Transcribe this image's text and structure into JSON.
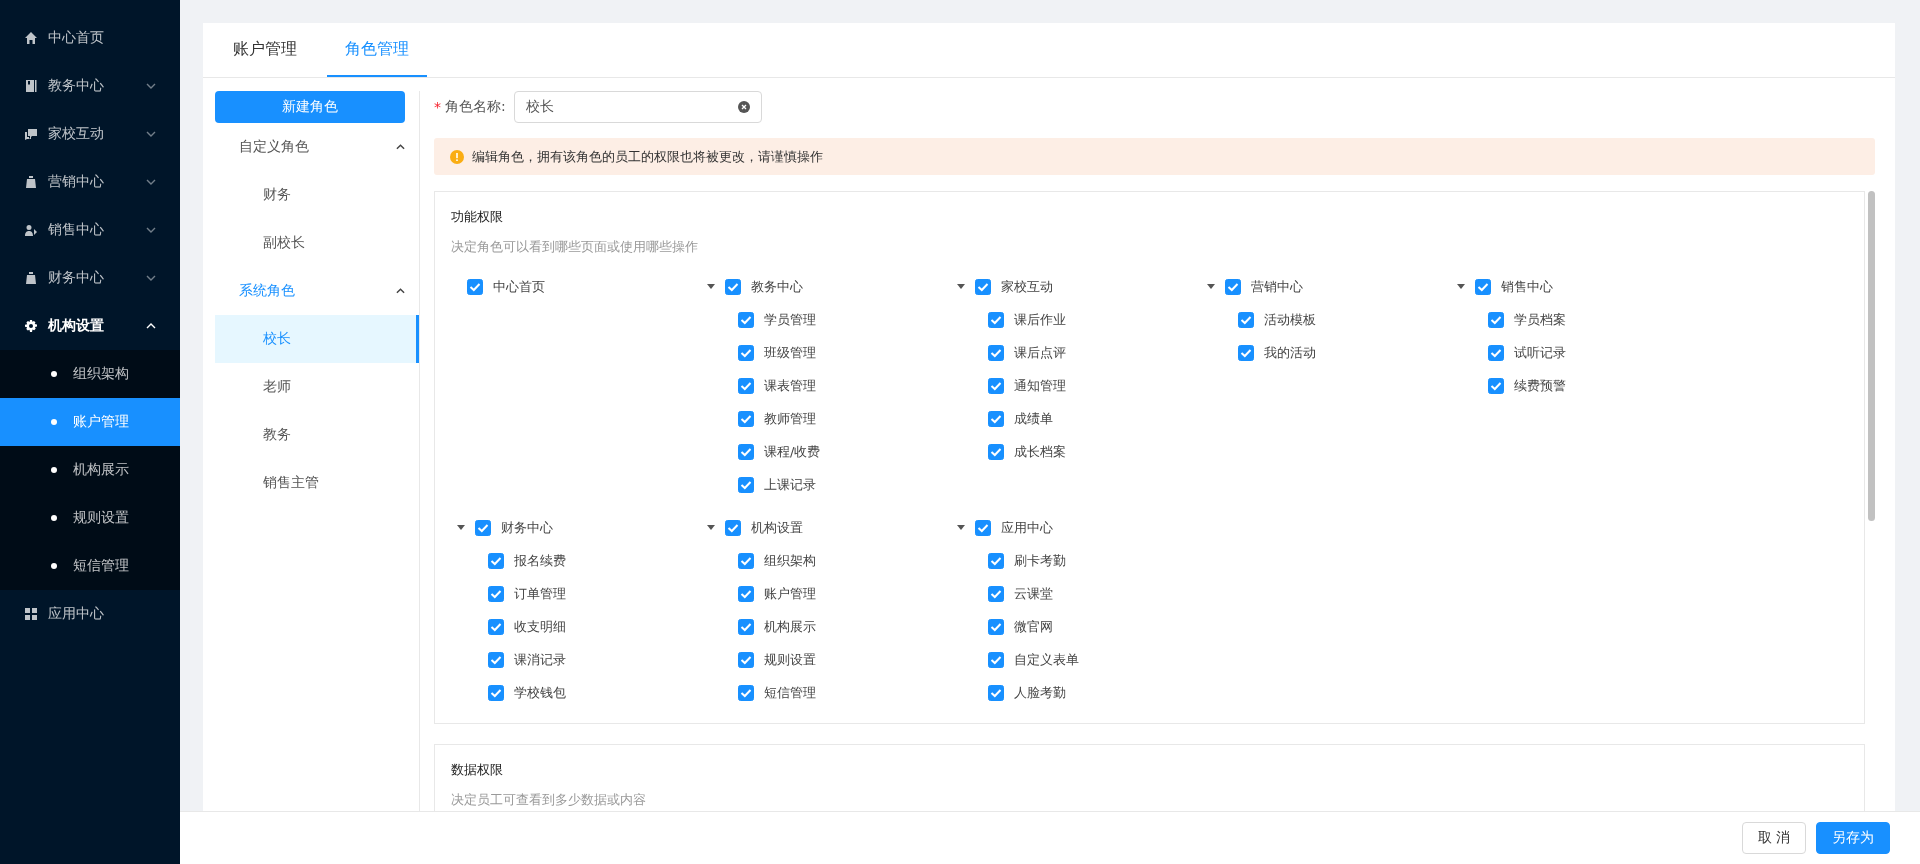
{
  "sidebar": {
    "items": [
      {
        "label": "中心首页",
        "kind": "link"
      },
      {
        "label": "教务中心",
        "kind": "menu",
        "expanded": false
      },
      {
        "label": "家校互动",
        "kind": "menu",
        "expanded": false
      },
      {
        "label": "营销中心",
        "kind": "menu",
        "expanded": false
      },
      {
        "label": "销售中心",
        "kind": "menu",
        "expanded": false
      },
      {
        "label": "财务中心",
        "kind": "menu",
        "expanded": false
      },
      {
        "label": "机构设置",
        "kind": "menu",
        "expanded": true,
        "children": [
          {
            "label": "组织架构",
            "selected": false
          },
          {
            "label": "账户管理",
            "selected": true
          },
          {
            "label": "机构展示",
            "selected": false
          },
          {
            "label": "规则设置",
            "selected": false
          },
          {
            "label": "短信管理",
            "selected": false
          }
        ]
      },
      {
        "label": "应用中心",
        "kind": "link"
      }
    ]
  },
  "tabs": [
    {
      "label": "账户管理",
      "selected": false
    },
    {
      "label": "角色管理",
      "selected": true
    }
  ],
  "role_list": {
    "new_button": "新建角色",
    "groups": [
      {
        "label": "自定义角色",
        "expanded": true,
        "active": false,
        "roles": [
          {
            "label": "财务",
            "selected": false
          },
          {
            "label": "副校长",
            "selected": false
          }
        ]
      },
      {
        "label": "系统角色",
        "expanded": true,
        "active": true,
        "roles": [
          {
            "label": "校长",
            "selected": true
          },
          {
            "label": "老师",
            "selected": false
          },
          {
            "label": "教务",
            "selected": false
          },
          {
            "label": "销售主管",
            "selected": false
          }
        ]
      }
    ]
  },
  "role_name": {
    "required_mark": "*",
    "label": "角色名称:",
    "value": "校长"
  },
  "alert": "编辑角色，拥有该角色的员工的权限也将被更改，请谨慎操作",
  "function_permissions": {
    "title": "功能权限",
    "description": "决定角色可以看到哪些页面或使用哪些操作",
    "rows": [
      [
        {
          "label": "中心首页",
          "checked": true
        },
        {
          "label": "教务中心",
          "checked": true,
          "expanded": true,
          "children": [
            {
              "label": "学员管理",
              "checked": true
            },
            {
              "label": "班级管理",
              "checked": true
            },
            {
              "label": "课表管理",
              "checked": true
            },
            {
              "label": "教师管理",
              "checked": true
            },
            {
              "label": "课程/收费",
              "checked": true
            },
            {
              "label": "上课记录",
              "checked": true
            }
          ]
        },
        {
          "label": "家校互动",
          "checked": true,
          "expanded": true,
          "children": [
            {
              "label": "课后作业",
              "checked": true
            },
            {
              "label": "课后点评",
              "checked": true
            },
            {
              "label": "通知管理",
              "checked": true
            },
            {
              "label": "成绩单",
              "checked": true
            },
            {
              "label": "成长档案",
              "checked": true
            }
          ]
        },
        {
          "label": "营销中心",
          "checked": true,
          "expanded": true,
          "children": [
            {
              "label": "活动模板",
              "checked": true
            },
            {
              "label": "我的活动",
              "checked": true
            }
          ]
        },
        {
          "label": "销售中心",
          "checked": true,
          "expanded": true,
          "children": [
            {
              "label": "学员档案",
              "checked": true
            },
            {
              "label": "试听记录",
              "checked": true
            },
            {
              "label": "续费预警",
              "checked": true
            }
          ]
        }
      ],
      [
        {
          "label": "财务中心",
          "checked": true,
          "expanded": true,
          "children": [
            {
              "label": "报名续费",
              "checked": true
            },
            {
              "label": "订单管理",
              "checked": true
            },
            {
              "label": "收支明细",
              "checked": true
            },
            {
              "label": "课消记录",
              "checked": true
            },
            {
              "label": "学校钱包",
              "checked": true
            }
          ]
        },
        {
          "label": "机构设置",
          "checked": true,
          "expanded": true,
          "children": [
            {
              "label": "组织架构",
              "checked": true
            },
            {
              "label": "账户管理",
              "checked": true
            },
            {
              "label": "机构展示",
              "checked": true
            },
            {
              "label": "规则设置",
              "checked": true
            },
            {
              "label": "短信管理",
              "checked": true
            }
          ]
        },
        {
          "label": "应用中心",
          "checked": true,
          "expanded": true,
          "children": [
            {
              "label": "刷卡考勤",
              "checked": true
            },
            {
              "label": "云课堂",
              "checked": true
            },
            {
              "label": "微官网",
              "checked": true
            },
            {
              "label": "自定义表单",
              "checked": true
            },
            {
              "label": "人脸考勤",
              "checked": true
            }
          ]
        }
      ]
    ]
  },
  "data_permissions": {
    "title": "数据权限",
    "description": "决定员工可查看到多少数据或内容"
  },
  "footer": {
    "cancel": "取 消",
    "save_as": "另存为"
  }
}
